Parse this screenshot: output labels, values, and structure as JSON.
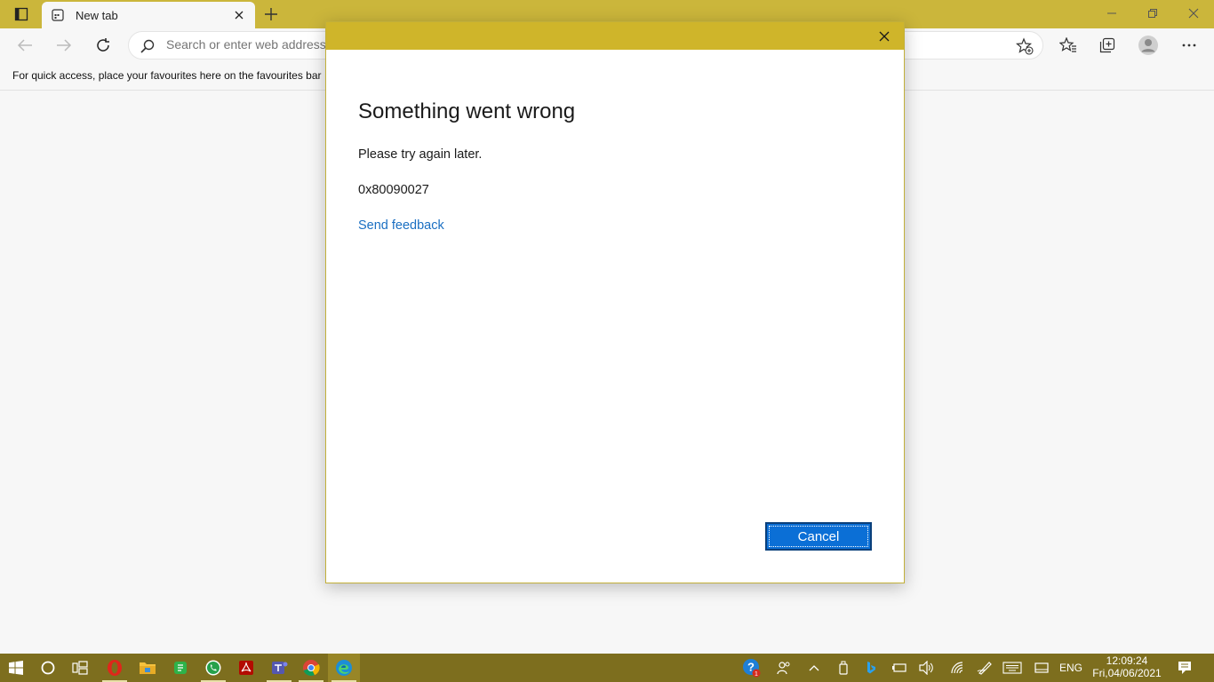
{
  "browser": {
    "tab_title": "New tab",
    "address_placeholder": "Search or enter web address",
    "favourites_hint": "For quick access, place your favourites here on the favourites bar"
  },
  "dialog": {
    "title": "Something went wrong",
    "message": "Please try again later.",
    "error_code": "0x80090027",
    "feedback_link": "Send feedback",
    "cancel_label": "Cancel"
  },
  "taskbar": {
    "apps": [
      "start-icon",
      "cortana-icon",
      "task-view-icon",
      "opera-icon",
      "file-explorer-icon",
      "app-icon",
      "whatsapp-icon",
      "acrobat-icon",
      "teams-icon",
      "chrome-icon",
      "edge-icon"
    ],
    "language": "ENG",
    "time": "12:09:24",
    "date": "Fri,04/06/2021"
  },
  "colors": {
    "accent": "#cfb52a",
    "taskbar": "#7d6e1e",
    "button": "#0b6fd6",
    "link": "#1a6fc2"
  }
}
